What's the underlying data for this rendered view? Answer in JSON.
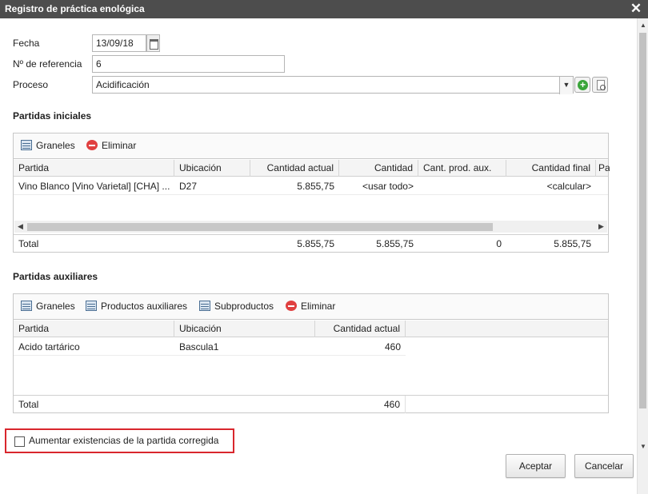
{
  "window": {
    "title": "Registro de práctica enológica"
  },
  "form": {
    "fecha_label": "Fecha",
    "fecha_value": "13/09/18",
    "referencia_label": "Nº de referencia",
    "referencia_value": "6",
    "proceso_label": "Proceso",
    "proceso_value": "Acidificación"
  },
  "partidas_iniciales": {
    "title": "Partidas iniciales",
    "toolbar": {
      "graneles": "Graneles",
      "eliminar": "Eliminar"
    },
    "columns": [
      "Partida",
      "Ubicación",
      "Cantidad actual",
      "Cantidad",
      "Cant. prod. aux.",
      "Cantidad final",
      "Pa"
    ],
    "rows": [
      {
        "partida": "Vino Blanco [Vino Varietal] [CHA] ...",
        "ubicacion": "D27",
        "cantidad_actual": "5.855,75",
        "cantidad": "<usar todo>",
        "cant_prod_aux": "",
        "cantidad_final": "<calcular>"
      }
    ],
    "total": {
      "label": "Total",
      "cantidad_actual": "5.855,75",
      "cantidad": "5.855,75",
      "cant_prod_aux": "0",
      "cantidad_final": "5.855,75"
    }
  },
  "partidas_auxiliares": {
    "title": "Partidas auxiliares",
    "toolbar": {
      "graneles": "Graneles",
      "productos_auxiliares": "Productos auxiliares",
      "subproductos": "Subproductos",
      "eliminar": "Eliminar"
    },
    "columns": [
      "Partida",
      "Ubicación",
      "Cantidad actual"
    ],
    "rows": [
      {
        "partida": "Acido tartárico",
        "ubicacion": "Bascula1",
        "cantidad_actual": "460"
      }
    ],
    "total": {
      "label": "Total",
      "cantidad_actual": "460"
    }
  },
  "checkbox": {
    "label": "Aumentar existencias de la partida corregida",
    "checked": false
  },
  "buttons": {
    "aceptar": "Aceptar",
    "cancelar": "Cancelar"
  },
  "colors": {
    "titlebar": "#4d4d4d",
    "highlight_border": "#d9262d",
    "add_green": "#3aa53a",
    "delete_red": "#e04040"
  }
}
